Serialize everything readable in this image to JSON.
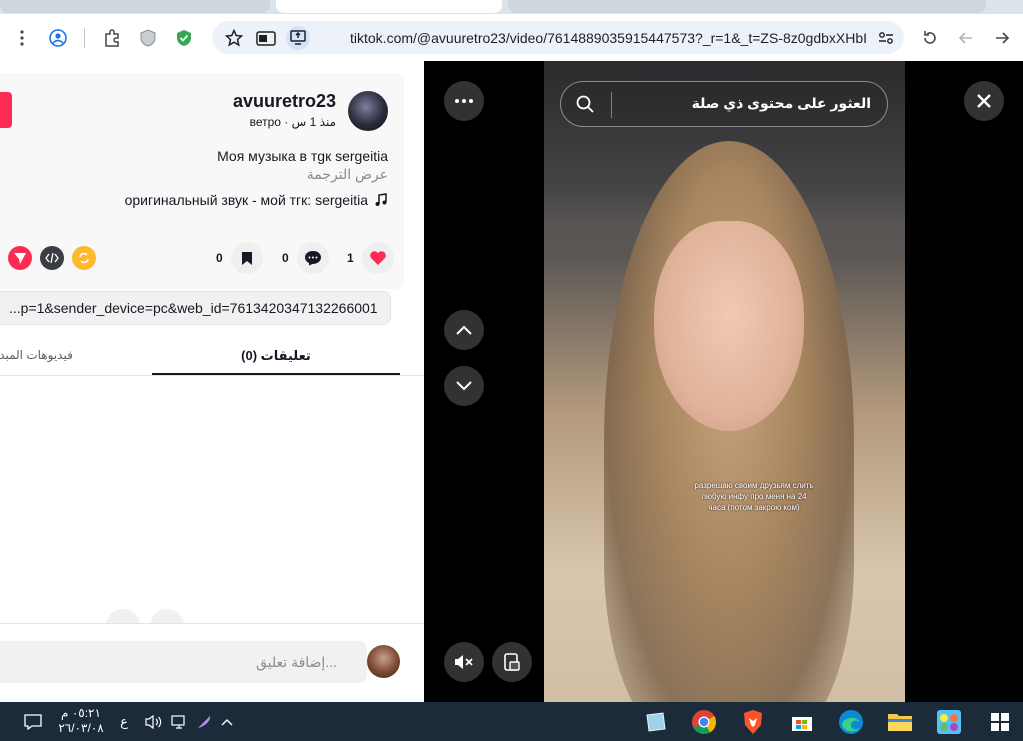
{
  "browser": {
    "url_host": "tiktok.com",
    "url_path": "/@avuuretro23/video/7614889035915447573?_r=1&_t=ZS-8z0gdbxXHbI"
  },
  "post": {
    "username": "avuuretro23",
    "subline": "ветро · منذ 1 س",
    "description": "Моя музыка в тgк sergeitia",
    "translate_link": "عرض الترجمة",
    "sound": "оригинальный звук - мой тгк: sergeitia",
    "likes": "1",
    "comments": "0",
    "saves": "0",
    "share_link": "...p=1&sender_device=pc&web_id=7613420347132266001"
  },
  "tabs": {
    "comments": "(0) تعليقات",
    "creator_videos": "فيديوهات المبدع"
  },
  "comment_box": {
    "placeholder": "إضافة تعليق..."
  },
  "player": {
    "search_text": "العثور على محتوى ذي صلة",
    "caption": "разрешаю своим друзьям слить любую инфу про меня на 24 часа (потом закрою ком)"
  },
  "taskbar": {
    "time": "٠٥:٢١ م",
    "date": "٢٦/٠٣/٠٨",
    "lang": "ع"
  },
  "colors": {
    "tiktok_red": "#fe2c55",
    "taskbar": "#1c2b3a"
  }
}
